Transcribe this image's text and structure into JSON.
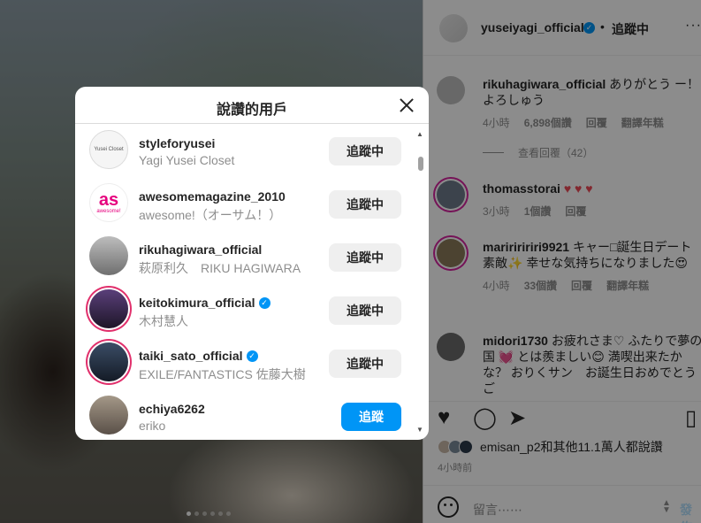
{
  "post": {
    "header": {
      "username": "yuseiyagi_official",
      "separator": "•",
      "follow_status": "追蹤中",
      "more": "···"
    },
    "carousel_dots": 6,
    "carousel_active": 0,
    "comments": [
      {
        "username": "rikuhagiwara_official",
        "text": "ありがとう ー！よろしゅう",
        "time": "4小時",
        "likes": "6,898個讚",
        "reply": "回覆",
        "translate": "翻譯年糕"
      },
      {
        "username": "thomasstorai",
        "text": "♥ ♥ ♥",
        "time": "3小時",
        "likes": "1個讚",
        "reply": "回覆"
      },
      {
        "username": "maririririri9921",
        "text": "キャー□誕生日デート素敵✨ 幸せな気持ちになりました😍",
        "time": "4小時",
        "likes": "33個讚",
        "reply": "回覆",
        "translate": "翻譯年糕"
      },
      {
        "username": "midori1730",
        "text": "お疲れさま♡ ふたりで夢の国 💓 とは羨ましい😊 満喫出来たかな？ おりくサン　お誕生日おめでとうご",
        "time": "",
        "likes": "",
        "reply": ""
      }
    ],
    "view_replies": "查看回覆（42）",
    "likes_text": "emisan_p2和其他11.1萬人都說讚",
    "likes_user": "emisan_p2",
    "time_ago": "4小時前",
    "comment_placeholder": "留言⋯⋯",
    "post_label": "發佈"
  },
  "modal": {
    "title": "說讚的用戶",
    "users": [
      {
        "username": "styleforyusei",
        "fullname": "Yagi Yusei Closet",
        "verified": false,
        "button": "追蹤中",
        "avatar_color": "#f5f5f5"
      },
      {
        "username": "awesomemagazine_2010",
        "fullname": "awesome!（オーサム！）",
        "verified": false,
        "button": "追蹤中",
        "avatar_color": "#ffffff"
      },
      {
        "username": "rikuhagiwara_official",
        "fullname": "萩原利久　RIKU HAGIWARA",
        "verified": false,
        "button": "追蹤中",
        "avatar_color": "#9a9a9a"
      },
      {
        "username": "keitokimura_official",
        "fullname": "木村慧人",
        "verified": true,
        "button": "追蹤中",
        "avatar_color": "#3a2a4a"
      },
      {
        "username": "taiki_sato_official",
        "fullname": "EXILE/FANTASTICS 佐藤大樹",
        "verified": true,
        "button": "追蹤中",
        "avatar_color": "#2c3a4a"
      },
      {
        "username": "echiya6262",
        "fullname": "eriko",
        "verified": false,
        "button": "追蹤",
        "avatar_color": "#8a8078"
      }
    ],
    "awesome_logo": "as",
    "awesome_sub": "awesome!",
    "closet_logo": "Yusei Closet"
  }
}
